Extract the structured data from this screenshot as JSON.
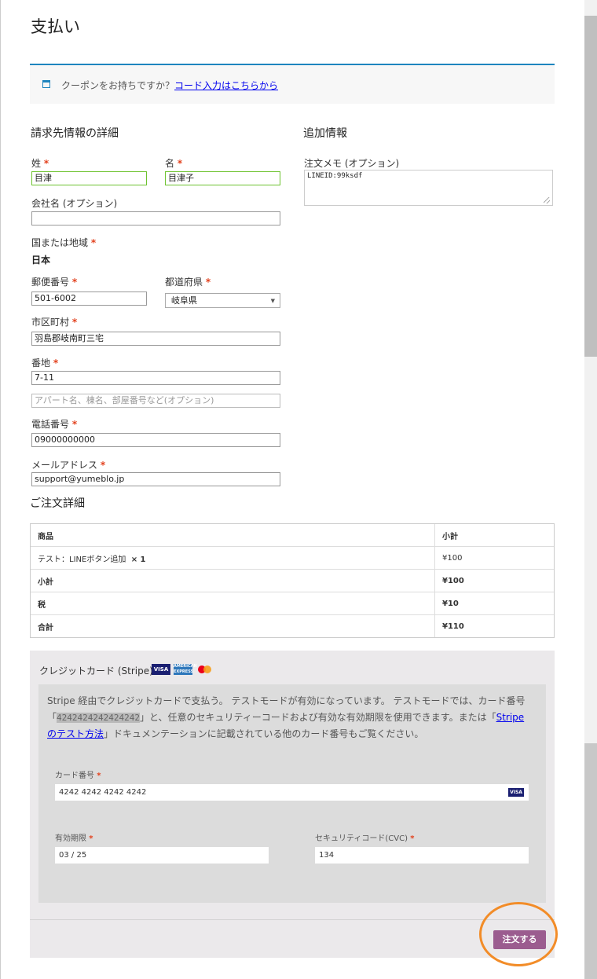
{
  "page": {
    "title": "支払い"
  },
  "coupon": {
    "text": "クーポンをお持ちですか？",
    "link": "コード入力はこちらから"
  },
  "billing": {
    "section_title": "請求先情報の詳細",
    "last_name_label": "姓",
    "last_name_value": "目津",
    "first_name_label": "名",
    "first_name_value": "目津子",
    "company_label": "会社名 (オプション)",
    "company_value": "",
    "country_label": "国または地域",
    "country_value": "日本",
    "postcode_label": "郵便番号",
    "postcode_value": "501-6002",
    "state_label": "都道府県",
    "state_value": "岐阜県",
    "city_label": "市区町村",
    "city_value": "羽島郡岐南町三宅",
    "address_label": "番地",
    "address_value": "7-11",
    "address2_placeholder": "アパート名、棟名、部屋番号など(オプション)",
    "phone_label": "電話番号",
    "phone_value": "09000000000",
    "email_label": "メールアドレス",
    "email_value": "support@yumeblo.jp",
    "required_mark": "*"
  },
  "additional": {
    "section_title": "追加情報",
    "notes_label": "注文メモ (オプション)",
    "notes_value": "LINEID:99ksdf"
  },
  "order": {
    "section_title": "ご注文詳細",
    "header_product": "商品",
    "header_subtotal": "小計",
    "item_name": "テスト：LINEボタン追加",
    "item_qty": "× 1",
    "item_price": "¥100",
    "subtotal_label": "小計",
    "subtotal_value": "¥100",
    "tax_label": "税",
    "tax_value": "¥10",
    "total_label": "合計",
    "total_value": "¥110"
  },
  "payment": {
    "method_label": "クレジットカード (Stripe)",
    "logo_visa": "VISA",
    "logo_amex": "AMERICAN EXPRESS",
    "desc_part1": "Stripe 経由でクレジットカードで支払う。 テストモードが有効になっています。 テストモードでは、カード番号「",
    "desc_card": "4242424242424242",
    "desc_part2": "」と、任意のセキュリティーコードおよび有効な有効期限を使用できます。または「",
    "desc_link": "Stripe のテスト方法",
    "desc_part3": "」ドキュメンテーションに記載されている他のカード番号もご覧ください。",
    "card_number_label": "カード番号",
    "card_number_value": "4242 4242 4242 4242",
    "expiry_label": "有効期限",
    "expiry_value": "03 / 25",
    "cvc_label": "セキュリティコード(CVC)",
    "cvc_value": "134",
    "place_order_label": "注文する"
  },
  "colors": {
    "accent_blue": "#1e85be",
    "button_purple": "#9b5c8f",
    "required_red": "#e2401c",
    "highlight_orange": "#f28c28"
  }
}
